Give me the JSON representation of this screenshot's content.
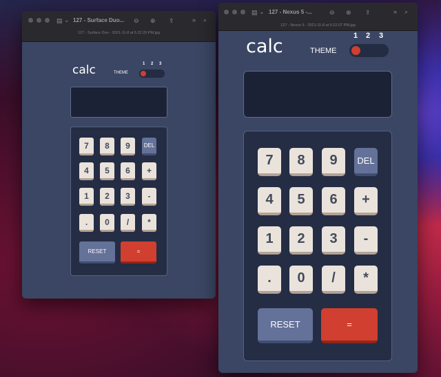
{
  "window_left": {
    "title": "127 - Surface Duo...",
    "subtitle": "127 - Surface Duo - 2021-11-8 at 5.22.20 PM.jpg"
  },
  "window_right": {
    "title": "127 - Nexus 5 -...",
    "subtitle": "127 - Nexus 5 - 2021-11-8 at 5.22.07 PM.jpg"
  },
  "toolbar": {
    "sidebar_icon": "▤",
    "chevron_icon": "⌄",
    "zoom_out_icon": "⊖",
    "zoom_in_icon": "⊕",
    "share_icon": "⇪",
    "more_icon": "»",
    "search_icon": "⌕"
  },
  "calc": {
    "logo": "calc",
    "theme_label": "THEME",
    "theme_numbers": [
      "1",
      "2",
      "3"
    ],
    "selected_theme": 1,
    "screen_value": "",
    "keys": [
      [
        "7",
        "8",
        "9",
        "DEL"
      ],
      [
        "4",
        "5",
        "6",
        "+"
      ],
      [
        "1",
        "2",
        "3",
        "-"
      ],
      [
        ".",
        "0",
        "/",
        "*"
      ]
    ],
    "reset_label": "RESET",
    "equals_label": "="
  },
  "colors": {
    "main_bg": "#3a4663",
    "keypad_bg": "#242d44",
    "screen_bg": "#1c2236",
    "key_bg": "#eae3dc",
    "key_shadow": "#b3a294",
    "del_reset_bg": "#647198",
    "equals_bg": "#d03f2f",
    "toggle_knob": "#d03f2f"
  }
}
